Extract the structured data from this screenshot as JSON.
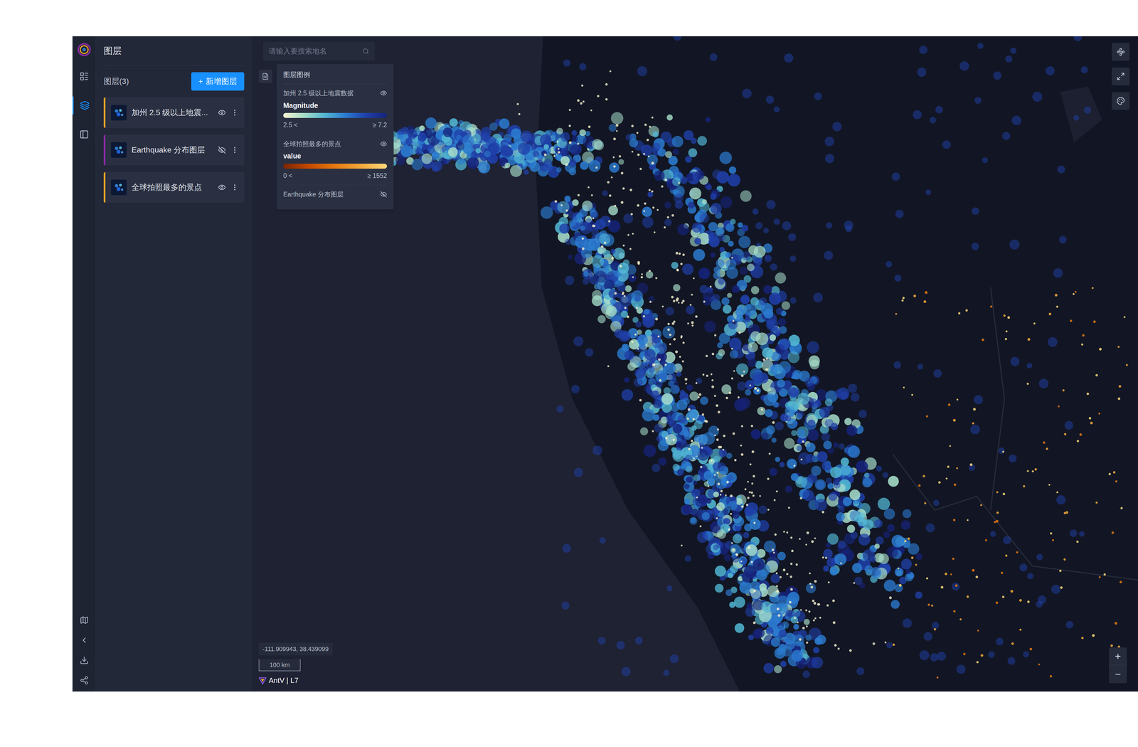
{
  "search": {
    "placeholder": "请输入要搜索地名"
  },
  "rail": [
    {
      "selected": false
    },
    {
      "selected": true
    },
    {
      "selected": false
    }
  ],
  "layers_panel": {
    "title": "图层",
    "count_label": "图层(3)",
    "add_button": {
      "icon": "+",
      "label": "新增图层"
    },
    "layers": [
      {
        "name": "加州 2.5 级以上地震...",
        "visible": true,
        "color": "#f5a623"
      },
      {
        "name": "Earthquake 分布图层",
        "visible": false,
        "color": "#8e2aa8"
      },
      {
        "name": "全球拍照最多的景点",
        "visible": true,
        "color": "#f5a623"
      }
    ]
  },
  "legend": {
    "title": "图层图例",
    "items": [
      {
        "layer": "加州 2.5 级以上地震数据",
        "visible": true,
        "field": "Magnitude",
        "min": "2.5 <",
        "max": "≥ 7.2",
        "colors": [
          "#f7f3cf",
          "#a6dcc9",
          "#52b6d3",
          "#2b7bd0",
          "#1f3fa8",
          "#16237a"
        ]
      },
      {
        "layer": "全球拍照最多的景点",
        "visible": true,
        "field": "value",
        "min": "0 <",
        "max": "≥ 1552",
        "colors": [
          "#7a2400",
          "#c44a00",
          "#e67a12",
          "#f4a93c",
          "#fbd97a"
        ]
      },
      {
        "layer": "Earthquake 分布图层",
        "visible": false
      }
    ]
  },
  "status": {
    "coordinates": "-111.909943, 38.439099",
    "scale": "100 km",
    "logo": "AntV | L7"
  },
  "zoom": {
    "in": "+",
    "out": "−"
  }
}
